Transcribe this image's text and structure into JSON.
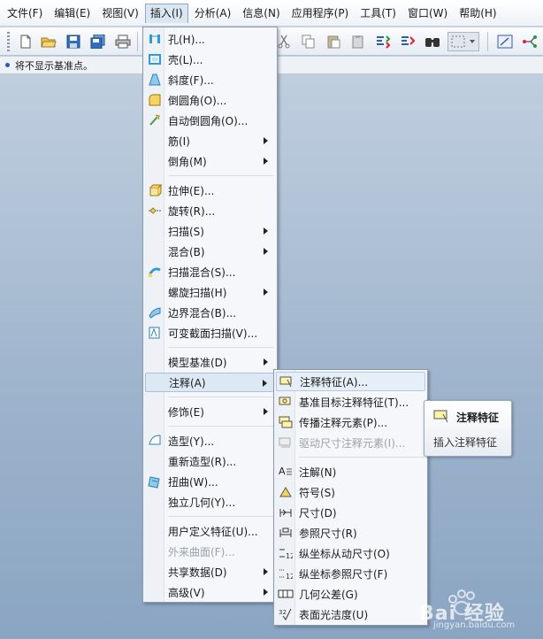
{
  "menubar": {
    "items": [
      "文件(F)",
      "编辑(E)",
      "视图(V)",
      "插入(I)",
      "分析(A)",
      "信息(N)",
      "应用程序(P)",
      "工具(T)",
      "窗口(W)",
      "帮助(H)"
    ]
  },
  "status": {
    "message": "将不显示基准点。"
  },
  "insert_menu": {
    "items": [
      {
        "label": "孔(H)...",
        "icon": "hole-icon"
      },
      {
        "label": "壳(L)...",
        "icon": "shell-icon"
      },
      {
        "label": "斜度(F)...",
        "icon": "draft-icon"
      },
      {
        "label": "倒圆角(O)...",
        "icon": "round-icon"
      },
      {
        "label": "自动倒圆角(O)...",
        "icon": "auto-round-icon"
      },
      {
        "label": "筋(I)",
        "icon": "",
        "submenu": true
      },
      {
        "label": "倒角(M)",
        "icon": "",
        "submenu": true
      },
      {
        "label": "拉伸(E)...",
        "icon": "extrude-icon"
      },
      {
        "label": "旋转(R)...",
        "icon": "revolve-icon"
      },
      {
        "label": "扫描(S)",
        "icon": "",
        "submenu": true
      },
      {
        "label": "混合(B)",
        "icon": "",
        "submenu": true
      },
      {
        "label": "扫描混合(S)...",
        "icon": "swept-blend-icon"
      },
      {
        "label": "螺旋扫描(H)",
        "icon": "",
        "submenu": true
      },
      {
        "label": "边界混合(B)...",
        "icon": "boundary-blend-icon"
      },
      {
        "label": "可变截面扫描(V)...",
        "icon": "variable-section-sweep-icon"
      },
      {
        "label": "模型基准(D)",
        "icon": "",
        "submenu": true
      },
      {
        "label": "注释(A)",
        "icon": "",
        "submenu": true
      },
      {
        "label": "修饰(E)",
        "icon": "",
        "submenu": true
      },
      {
        "label": "造型(Y)...",
        "icon": "style-icon"
      },
      {
        "label": "重新造型(R)...",
        "icon": ""
      },
      {
        "label": "扭曲(W)...",
        "icon": "warp-icon"
      },
      {
        "label": "独立几何(Y)...",
        "icon": ""
      },
      {
        "label": "用户定义特征(U)...",
        "icon": ""
      },
      {
        "label": "外来曲面(F)...",
        "icon": "",
        "disabled": true
      },
      {
        "label": "共享数据(D)",
        "icon": "",
        "submenu": true
      },
      {
        "label": "高级(V)",
        "icon": "",
        "submenu": true
      }
    ]
  },
  "annotation_menu": {
    "items": [
      {
        "label": "注释特征(A)...",
        "icon": "annotation-feature-icon"
      },
      {
        "label": "基准目标注释特征(T)...",
        "icon": "datum-target-annotation-icon"
      },
      {
        "label": "传播注释元素(P)...",
        "icon": "propagate-annotation-icon"
      },
      {
        "label": "驱动尺寸注释元素(I)...",
        "icon": "driving-dimension-annotation-icon",
        "disabled": true
      },
      {
        "label": "注解(N)",
        "icon": "note-icon"
      },
      {
        "label": "符号(S)",
        "icon": "symbol-icon"
      },
      {
        "label": "尺寸(D)",
        "icon": "dimension-icon"
      },
      {
        "label": "参照尺寸(R)",
        "icon": "reference-dimension-icon"
      },
      {
        "label": "纵坐标从动尺寸(O)",
        "icon": "ordinate-driven-dimension-icon"
      },
      {
        "label": "纵坐标参照尺寸(F)",
        "icon": "ordinate-reference-dimension-icon"
      },
      {
        "label": "几何公差(G)",
        "icon": "geometric-tolerance-icon"
      },
      {
        "label": "表面光洁度(U)",
        "icon": "surface-finish-icon"
      }
    ]
  },
  "tooltip": {
    "title": "注释特征",
    "description": "插入注释特征"
  },
  "watermark": {
    "text": "Bai 经验",
    "url": "jingyan.baidu.com"
  },
  "colors": {
    "menu_highlight": "#dde8f5",
    "accent_blue": "#2a5db0",
    "background": "#9db3cc"
  }
}
